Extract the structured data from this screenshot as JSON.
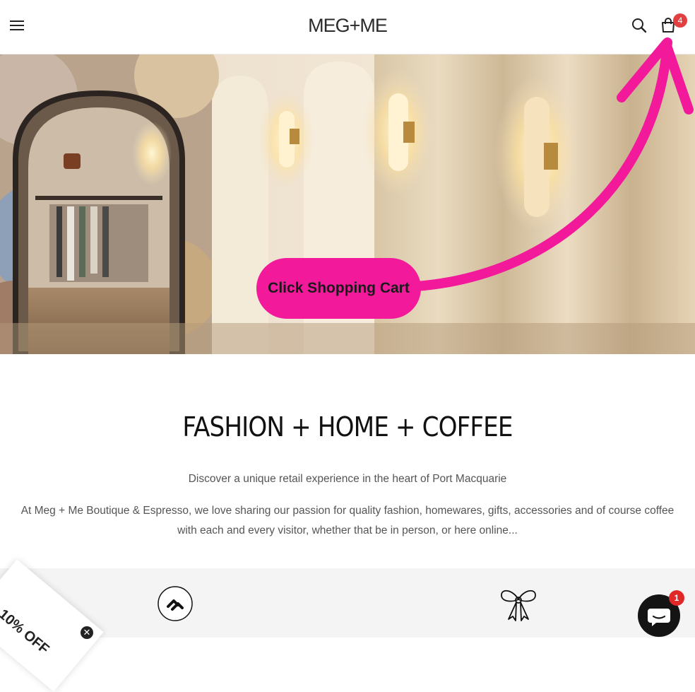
{
  "header": {
    "logo": "MEG+ME",
    "cart_count": "4"
  },
  "hero": {
    "cta_label": "Click Shopping Cart",
    "accent": "#f2199b"
  },
  "intro": {
    "title": "FASHION + HOME + COFFEE",
    "subtitle": "Discover a unique retail experience in the heart of Port Macquarie",
    "body": "At Meg + Me Boutique & Espresso, we love sharing our passion for quality fashion, homewares, gifts, accessories and of course coffee with each and every visitor, whether that be in person, or here online..."
  },
  "features": {
    "icons": [
      "afterpay-icon",
      "gift-bow-icon"
    ]
  },
  "discount": {
    "label": "10% OFF",
    "close_icon": "close-icon"
  },
  "chat": {
    "badge": "1",
    "icon": "chat-icon"
  }
}
